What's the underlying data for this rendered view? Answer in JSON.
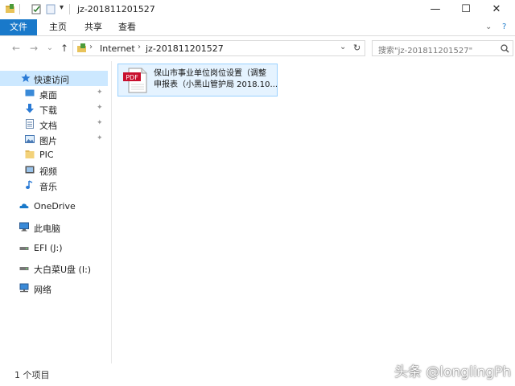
{
  "window": {
    "title": "jz-201811201527",
    "minimize": "—",
    "maximize": "☐",
    "close": "✕"
  },
  "ribbon": {
    "tabs": [
      {
        "label": "文件"
      },
      {
        "label": "主页"
      },
      {
        "label": "共享"
      },
      {
        "label": "查看"
      }
    ],
    "collapse_glyph": "⌄",
    "help_glyph": "?"
  },
  "nav": {
    "back": "←",
    "forward": "→",
    "recent": "⌄",
    "up": "↑",
    "breadcrumb": [
      "Internet",
      "jz-201811201527"
    ],
    "dropdown": "⌄",
    "refresh": "↻",
    "search_placeholder": "搜索\"jz-201811201527\""
  },
  "sidebar": {
    "items": [
      {
        "label": "快速访问",
        "icon": "star-icon"
      },
      {
        "label": "桌面",
        "icon": "desktop-icon",
        "pinned": "📌"
      },
      {
        "label": "下载",
        "icon": "download-icon",
        "pinned": "📌"
      },
      {
        "label": "文档",
        "icon": "document-icon",
        "pinned": "📌"
      },
      {
        "label": "图片",
        "icon": "picture-icon",
        "pinned": "📌"
      },
      {
        "label": "PIC",
        "icon": "folder-icon"
      },
      {
        "label": "视频",
        "icon": "video-icon"
      },
      {
        "label": "音乐",
        "icon": "music-icon"
      },
      {
        "label": "OneDrive",
        "icon": "cloud-icon"
      },
      {
        "label": "此电脑",
        "icon": "computer-icon"
      },
      {
        "label": "EFI (J:)",
        "icon": "drive-icon"
      },
      {
        "label": "大白菜U盘 (I:)",
        "icon": "drive-icon"
      },
      {
        "label": "网络",
        "icon": "network-icon"
      }
    ]
  },
  "files": [
    {
      "name_line1": "保山市事业单位岗位设置（调整",
      "name_line2": "申报表（小黑山管护局  2018.10...",
      "icon": "pdf-icon",
      "icon_text": "PDF"
    }
  ],
  "status": {
    "count": "1 个项目"
  },
  "watermark": "头条 @longlingPh",
  "colors": {
    "accent": "#1979ca",
    "selection": "#cce8ff",
    "pdf_red": "#c8102e"
  }
}
